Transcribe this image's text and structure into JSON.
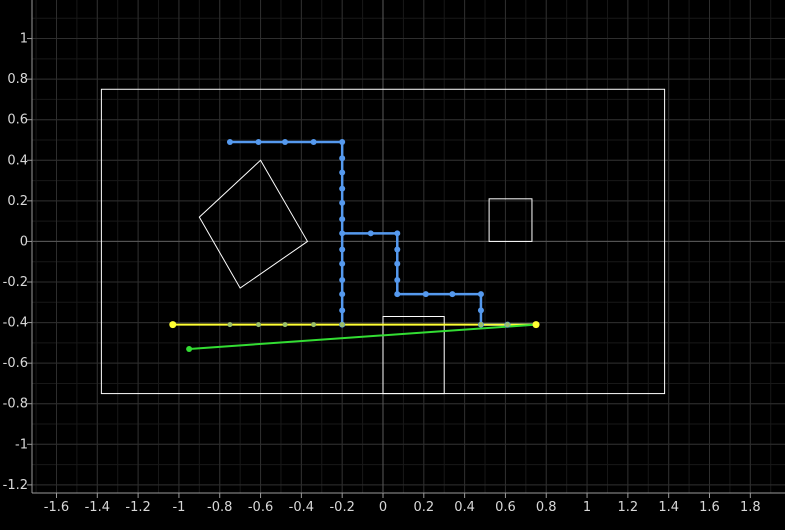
{
  "chart_data": {
    "type": "scatter",
    "grid": true,
    "xlim": [
      -1.72,
      1.97
    ],
    "ylim": [
      -1.24,
      1.19
    ],
    "x_ticks": [
      -1.6,
      -1.4,
      -1.2,
      -1,
      -0.8,
      -0.6,
      -0.4,
      -0.2,
      0,
      0.2,
      0.4,
      0.6,
      0.8,
      1,
      1.2,
      1.4,
      1.6,
      1.8
    ],
    "y_ticks": [
      1,
      0.8,
      0.6,
      0.4,
      0.2,
      0,
      -0.2,
      -0.4,
      -0.6,
      -0.8,
      -1,
      -1.2
    ],
    "minor_step": 0.1,
    "colors": {
      "background": "#000000",
      "grid_major": "#2e2e2e",
      "grid_minor": "#181818",
      "axis": "#9a9a9a",
      "rect": "#ffffff",
      "path": "#5599ee",
      "yellow": "#ffff33",
      "green": "#33dd33"
    },
    "rectangles": [
      {
        "x1": -1.38,
        "y1": -0.75,
        "x2": 1.38,
        "y2": 0.75
      },
      {
        "x1": 0.52,
        "y1": 0.0,
        "x2": 0.73,
        "y2": 0.21
      },
      {
        "x1": 0.0,
        "y1": -0.75,
        "x2": 0.3,
        "y2": -0.37
      }
    ],
    "polygons": [
      {
        "points": [
          [
            -0.6,
            0.4
          ],
          [
            -0.37,
            0.0
          ],
          [
            -0.7,
            -0.23
          ],
          [
            -0.9,
            0.12
          ]
        ]
      }
    ],
    "path": {
      "points": [
        [
          -0.75,
          0.49
        ],
        [
          -0.61,
          0.49
        ],
        [
          -0.48,
          0.49
        ],
        [
          -0.34,
          0.49
        ],
        [
          -0.2,
          0.49
        ],
        [
          -0.2,
          0.41
        ],
        [
          -0.2,
          0.34
        ],
        [
          -0.2,
          0.26
        ],
        [
          -0.2,
          0.19
        ],
        [
          -0.2,
          0.11
        ],
        [
          -0.2,
          0.04
        ],
        [
          -0.06,
          0.04
        ],
        [
          0.07,
          0.04
        ],
        [
          0.07,
          -0.04
        ],
        [
          0.07,
          -0.11
        ],
        [
          0.07,
          -0.19
        ],
        [
          0.07,
          -0.26
        ],
        [
          0.21,
          -0.26
        ],
        [
          0.34,
          -0.26
        ],
        [
          0.48,
          -0.26
        ],
        [
          0.48,
          -0.34
        ],
        [
          0.48,
          -0.41
        ],
        [
          0.61,
          -0.41
        ],
        [
          0.75,
          -0.41
        ]
      ],
      "extra_points": [
        [
          -0.2,
          -0.04
        ],
        [
          -0.2,
          -0.11
        ],
        [
          -0.2,
          -0.19
        ],
        [
          -0.2,
          -0.26
        ],
        [
          -0.2,
          -0.34
        ],
        [
          -0.2,
          -0.41
        ]
      ]
    },
    "yellow_line": {
      "points": [
        [
          -1.03,
          -0.41
        ],
        [
          -0.75,
          -0.41
        ],
        [
          -0.61,
          -0.41
        ],
        [
          -0.48,
          -0.41
        ],
        [
          -0.34,
          -0.41
        ],
        [
          -0.2,
          -0.41
        ],
        [
          0.48,
          -0.41
        ],
        [
          0.61,
          -0.41
        ],
        [
          0.75,
          -0.41
        ]
      ],
      "endpoints": [
        [
          -1.03,
          -0.41
        ],
        [
          0.75,
          -0.41
        ]
      ]
    },
    "green_line": {
      "points": [
        [
          -0.95,
          -0.53
        ],
        [
          0.75,
          -0.41
        ]
      ]
    }
  }
}
